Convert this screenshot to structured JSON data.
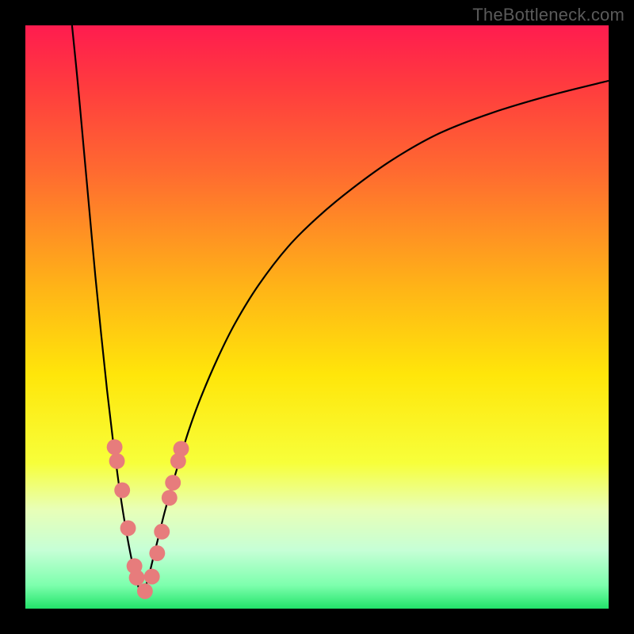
{
  "watermark": "TheBottleneck.com",
  "chart_data": {
    "type": "line",
    "title": "",
    "xlabel": "",
    "ylabel": "",
    "xlim": [
      0,
      100
    ],
    "ylim": [
      0,
      100
    ],
    "notch_x": 20,
    "background_gradient": {
      "stops": [
        {
          "pct": 0,
          "color": "#ff1c4f"
        },
        {
          "pct": 10,
          "color": "#ff3a3f"
        },
        {
          "pct": 25,
          "color": "#ff6a30"
        },
        {
          "pct": 45,
          "color": "#ffb417"
        },
        {
          "pct": 60,
          "color": "#ffe60a"
        },
        {
          "pct": 75,
          "color": "#f7ff3a"
        },
        {
          "pct": 83,
          "color": "#e8ffb7"
        },
        {
          "pct": 90,
          "color": "#c6ffd6"
        },
        {
          "pct": 96,
          "color": "#7dffad"
        },
        {
          "pct": 100,
          "color": "#22e36a"
        }
      ]
    },
    "series": [
      {
        "name": "left-branch",
        "x": [
          8,
          9,
          10,
          11,
          12,
          13,
          14,
          15,
          16,
          17,
          18,
          19,
          20
        ],
        "y": [
          100,
          90,
          79,
          68,
          57,
          47,
          37.5,
          29,
          21.5,
          15,
          9.5,
          5,
          2
        ]
      },
      {
        "name": "right-branch",
        "x": [
          20,
          21,
          22,
          23,
          24,
          26,
          28,
          30,
          33,
          36,
          40,
          45,
          50,
          56,
          63,
          71,
          80,
          90,
          100
        ],
        "y": [
          2,
          5,
          9,
          13,
          17,
          24,
          30.5,
          36,
          43,
          49,
          55.5,
          62,
          67,
          72,
          77,
          81.5,
          85,
          88,
          90.5
        ]
      }
    ],
    "markers": {
      "name": "fit-beads",
      "color": "#e77c7c",
      "radius_pct": 1.35,
      "points": [
        {
          "x": 15.3,
          "y": 27.7
        },
        {
          "x": 15.7,
          "y": 25.3
        },
        {
          "x": 16.6,
          "y": 20.3
        },
        {
          "x": 17.6,
          "y": 13.8
        },
        {
          "x": 18.7,
          "y": 7.3
        },
        {
          "x": 19.1,
          "y": 5.3
        },
        {
          "x": 20.5,
          "y": 3.0
        },
        {
          "x": 21.7,
          "y": 5.5
        },
        {
          "x": 22.6,
          "y": 9.5
        },
        {
          "x": 23.4,
          "y": 13.2
        },
        {
          "x": 24.7,
          "y": 19.0
        },
        {
          "x": 25.3,
          "y": 21.6
        },
        {
          "x": 26.2,
          "y": 25.3
        },
        {
          "x": 26.7,
          "y": 27.4
        }
      ]
    }
  }
}
